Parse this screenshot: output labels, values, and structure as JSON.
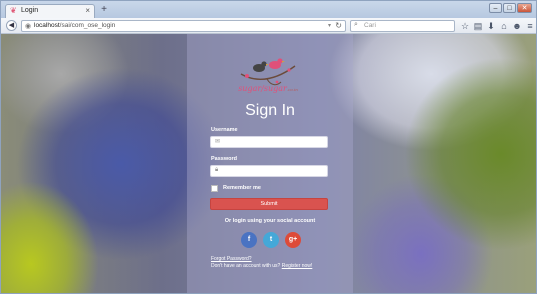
{
  "browser": {
    "tab_title": "Login",
    "tab_close": "×",
    "new_tab": "+",
    "url_host": "localhost",
    "url_path": "/sai/com_ose_login",
    "search_placeholder": "Cari",
    "controls": {
      "minimize": "–",
      "maximize": "□",
      "close": "✕"
    }
  },
  "page": {
    "logo_text": "sugar/sugar",
    "logo_sub": ".co.in",
    "heading": "Sign In",
    "username_label": "Username",
    "password_label": "Password",
    "remember_label": "Remember me",
    "submit_label": "Submit",
    "social_prompt": "Or login using your social account",
    "social": {
      "facebook": "f",
      "twitter": "t",
      "google": "g+"
    },
    "forgot_link": "Forgot Password?",
    "register_prefix": "Don't have an account with us?",
    "register_link": "Register now!"
  },
  "colors": {
    "submit": "#d9534f",
    "facebook": "#4a73c2",
    "twitter": "#45a8d8",
    "google": "#dd4b39",
    "logo_pink": "#e0517a"
  }
}
